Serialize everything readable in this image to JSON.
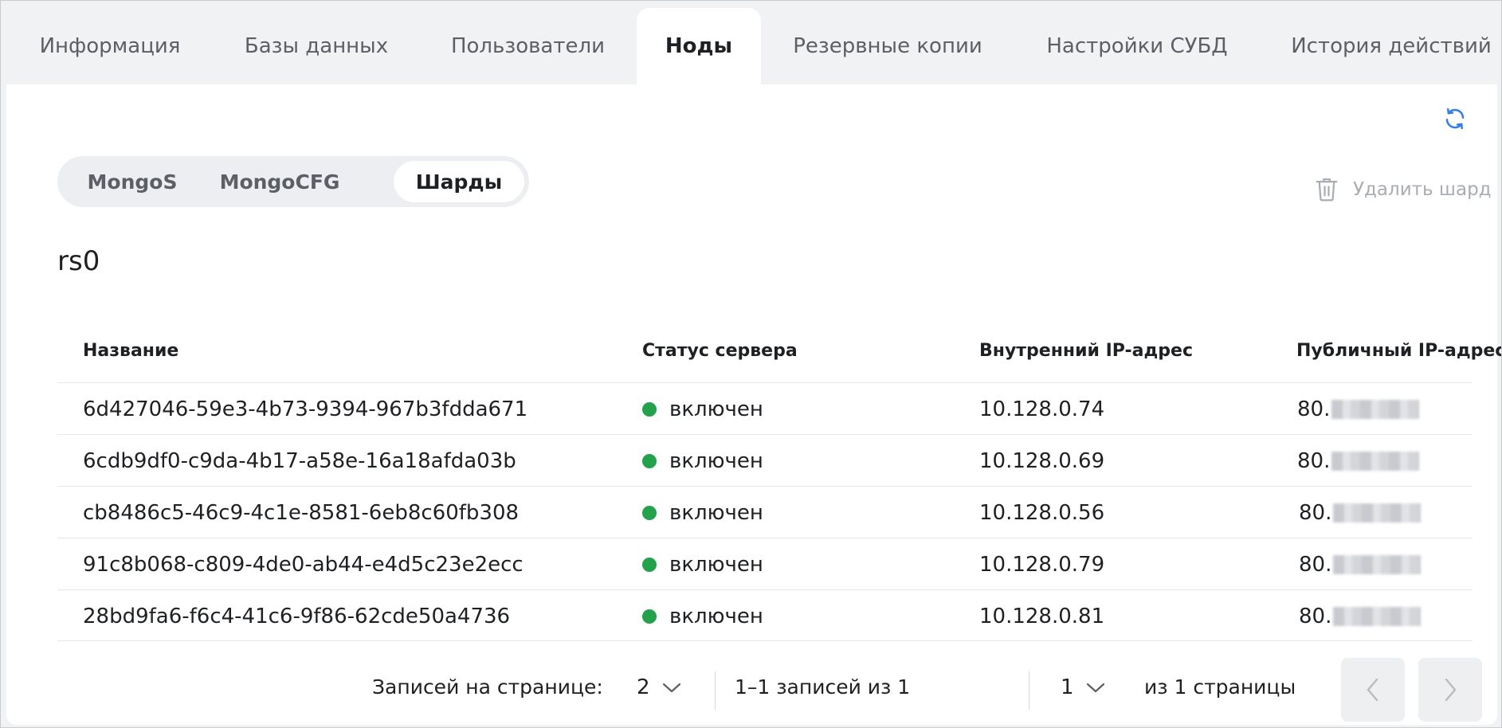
{
  "tabs": [
    {
      "label": "Информация"
    },
    {
      "label": "Базы данных"
    },
    {
      "label": "Пользователи"
    },
    {
      "label": "Ноды"
    },
    {
      "label": "Резервные копии"
    },
    {
      "label": "Настройки СУБД"
    },
    {
      "label": "История действий"
    }
  ],
  "active_tab": "Ноды",
  "segments": [
    {
      "label": "MongoS"
    },
    {
      "label": "MongoCFG"
    },
    {
      "label": "Шарды"
    }
  ],
  "active_segment": "Шарды",
  "delete_shard_label": "Удалить шард",
  "shard_name": "rs0",
  "table": {
    "headers": [
      "Название",
      "Статус сервера",
      "Внутренний IP-адрес",
      "Публичный IP-адрес"
    ],
    "rows": [
      {
        "name": "6d427046-59e3-4b73-9394-967b3fdda671",
        "status": "включен",
        "internal_ip": "10.128.0.74",
        "public_ip": "80."
      },
      {
        "name": "6cdb9df0-c9da-4b17-a58e-16a18afda03b",
        "status": "включен",
        "internal_ip": "10.128.0.69",
        "public_ip": "80."
      },
      {
        "name": "cb8486c5-46c9-4c1e-8581-6eb8c60fb308",
        "status": "включен",
        "internal_ip": "10.128.0.56",
        "public_ip": "80."
      },
      {
        "name": "91c8b068-c809-4de0-ab44-e4d5c23e2ecc",
        "status": "включен",
        "internal_ip": "10.128.0.79",
        "public_ip": "80."
      },
      {
        "name": "28bd9fa6-f6c4-41c6-9f86-62cde50a4736",
        "status": "включен",
        "internal_ip": "10.128.0.81",
        "public_ip": "80."
      }
    ]
  },
  "pagination": {
    "per_page_label": "Записей на странице:",
    "per_page_value": "2",
    "range_label": "1–1 записей из 1",
    "page_value": "1",
    "pages_label": "из 1 страницы"
  },
  "icons": {
    "refresh": "refresh-icon",
    "trash": "trash-icon",
    "chevron_down": "chevron-down-icon",
    "prev": "chevron-left-icon",
    "next": "chevron-right-icon"
  },
  "colors": {
    "accent": "#2f7cf6",
    "status_on": "#22a24a",
    "muted": "#a9acb2"
  }
}
